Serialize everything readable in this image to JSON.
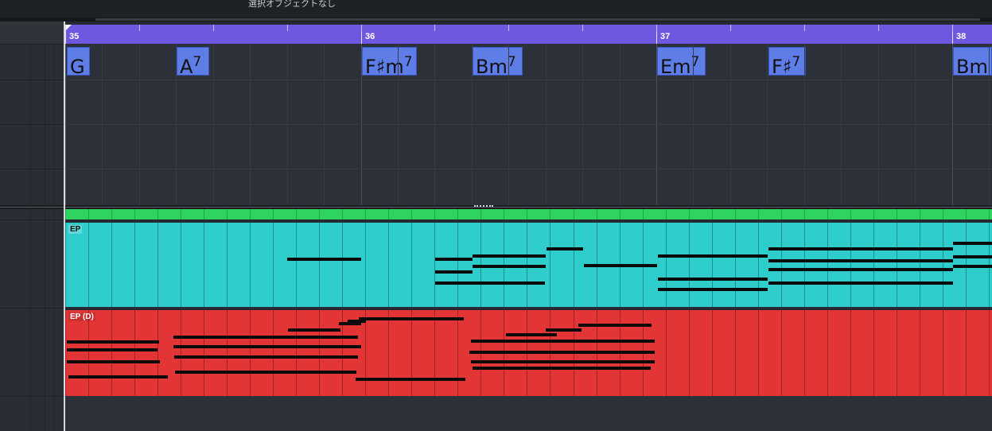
{
  "toolbar": {
    "status": "選択オブジェクトなし"
  },
  "ruler": {
    "bars": [
      {
        "label": "35"
      },
      {
        "label": "36"
      },
      {
        "label": "37"
      },
      {
        "label": "38"
      }
    ]
  },
  "chord_track": {
    "chords": [
      {
        "root": "G",
        "quality": ""
      },
      {
        "root": "A",
        "quality": "7"
      },
      {
        "root": "F♯m",
        "quality": "7"
      },
      {
        "root": "Bm",
        "quality": "7"
      },
      {
        "root": "Em",
        "quality": "7"
      },
      {
        "root": "F♯",
        "quality": "7"
      },
      {
        "root": "Bm",
        "quality": ""
      }
    ]
  },
  "tracks": [
    {
      "name": "EP",
      "color": "#2fcccc"
    },
    {
      "name": "EP (D)",
      "color": "#e33535"
    }
  ],
  "colors": {
    "ruler": "#6f57e0",
    "chord_event": "#5f7de6",
    "green_track": "#2fd35f"
  },
  "icons": {
    "ruler_marker": "position-marker-icon",
    "divider_grip": "drag-grip-icon"
  }
}
